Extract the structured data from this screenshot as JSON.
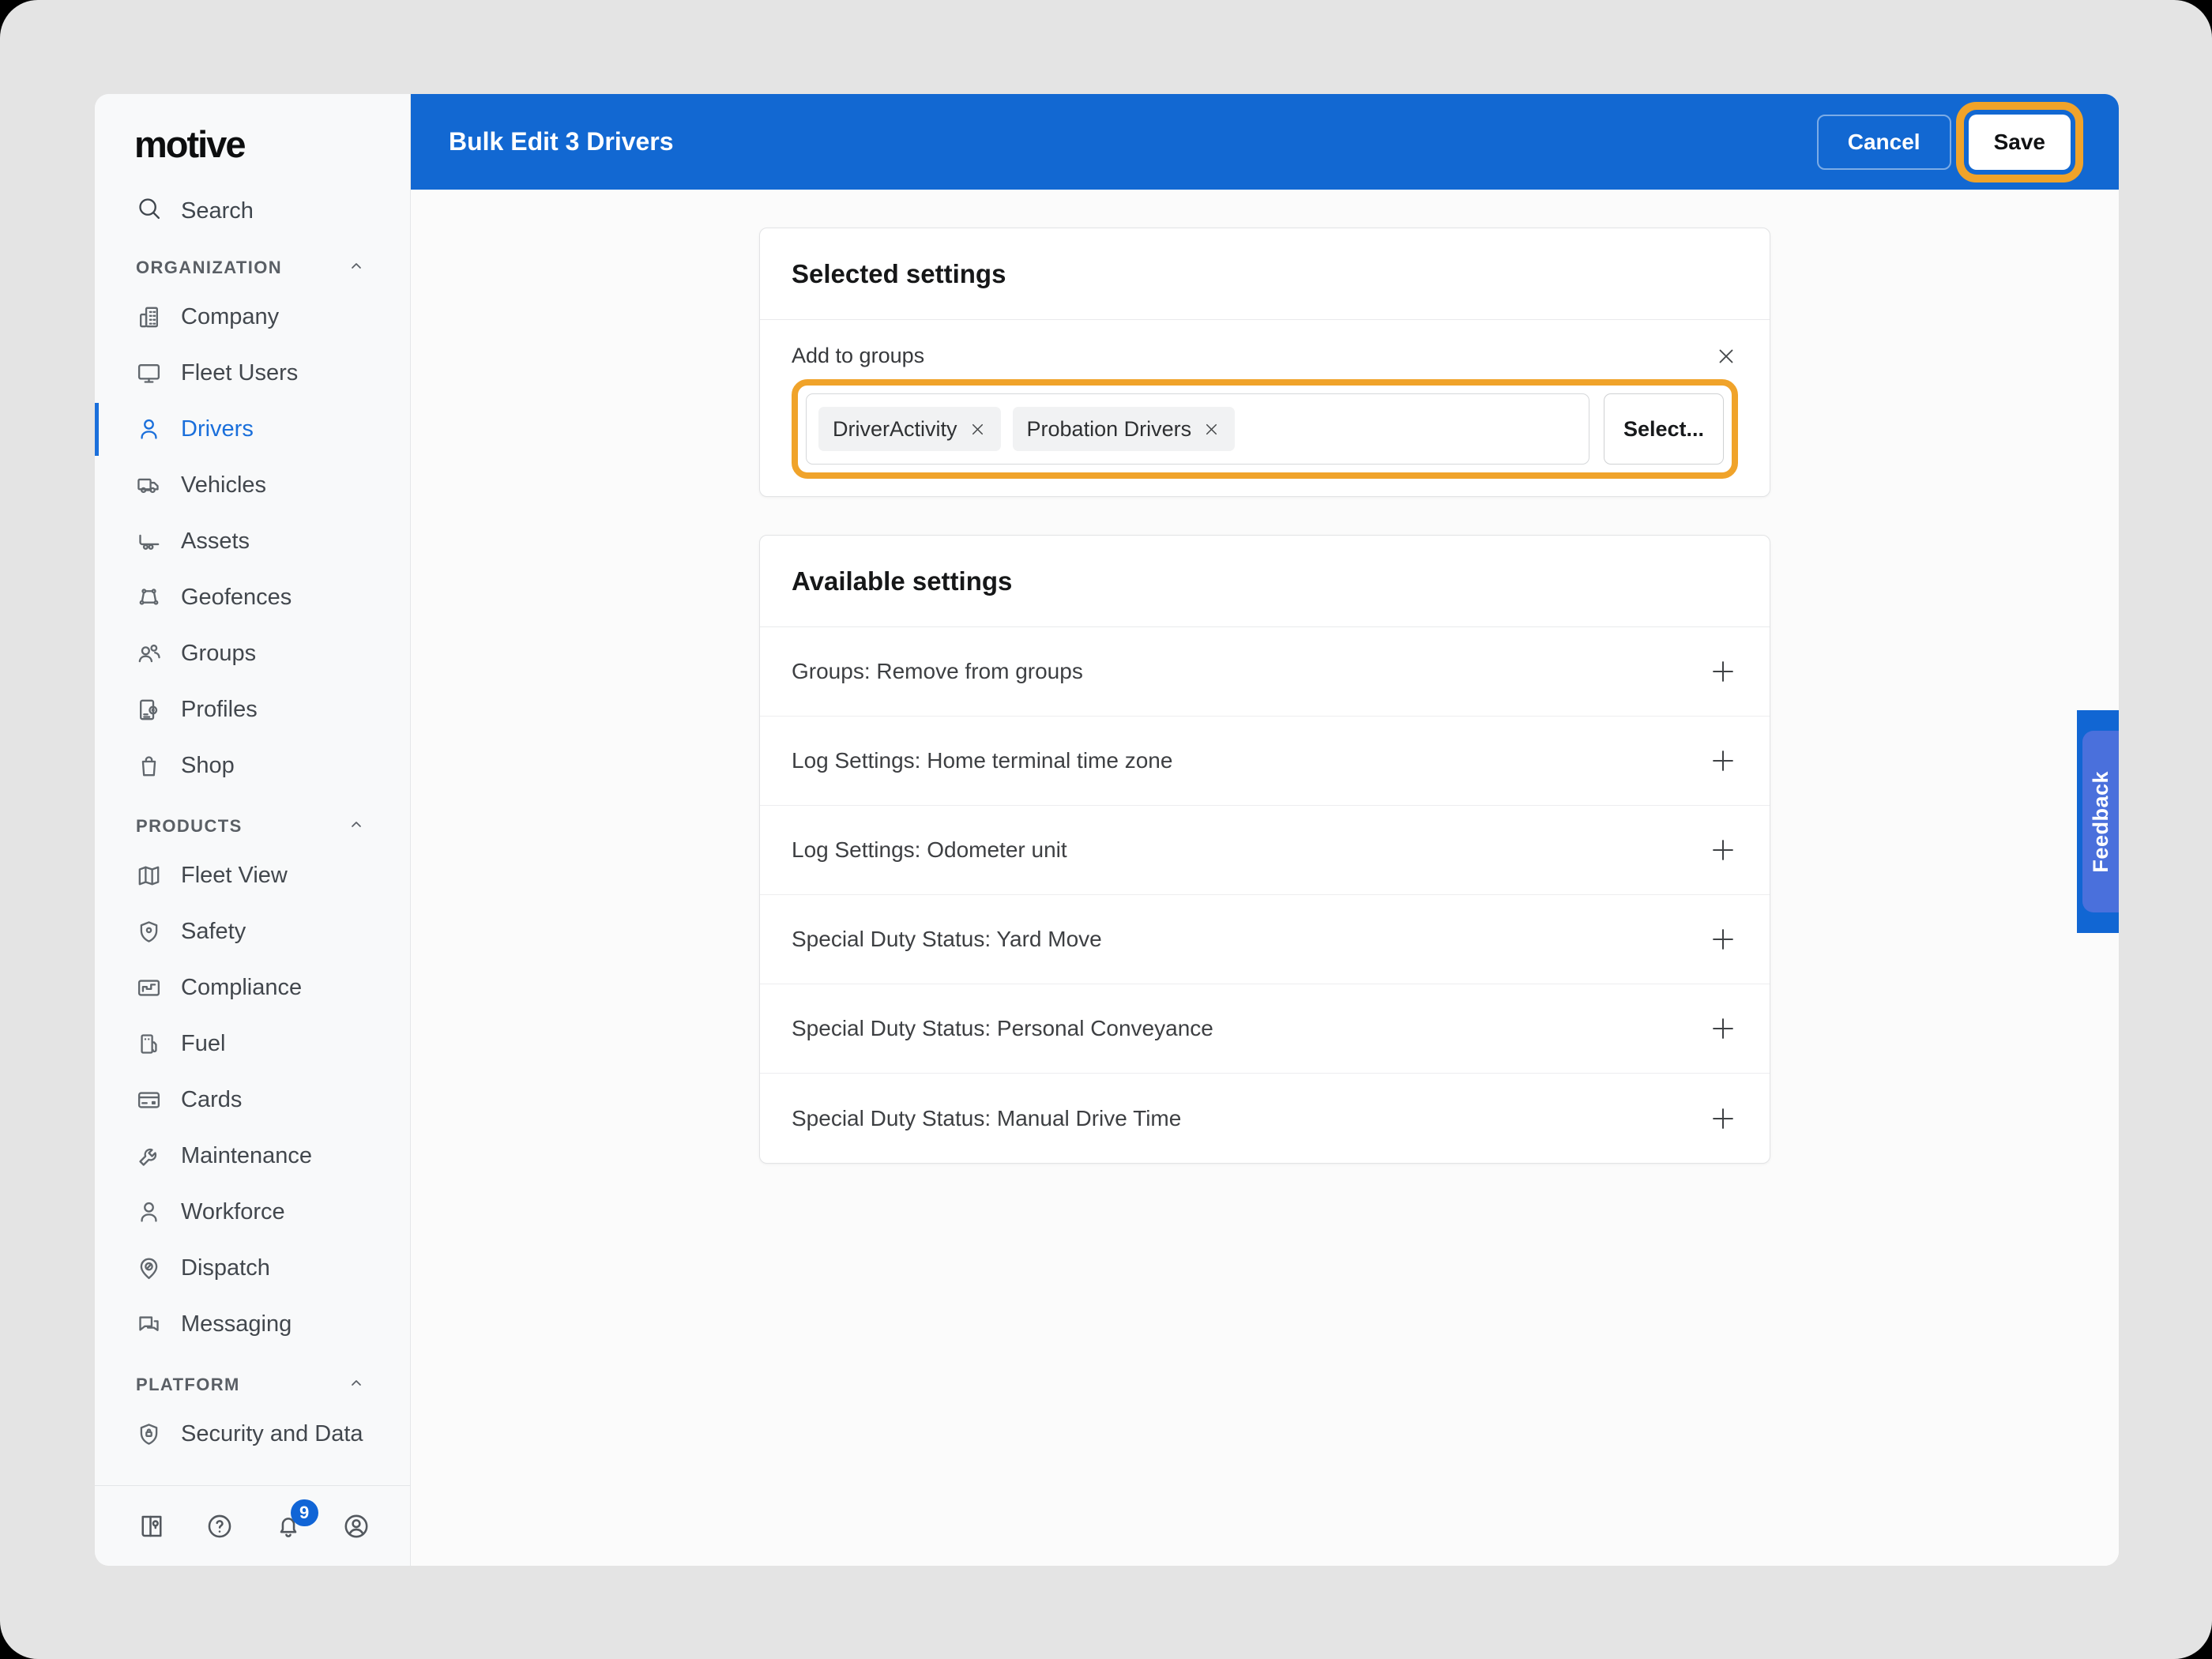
{
  "header": {
    "title": "Bulk Edit 3 Drivers",
    "cancel_label": "Cancel",
    "save_label": "Save"
  },
  "sidebar": {
    "logo": "motive",
    "search": {
      "label": "Search",
      "icon": "search-icon"
    },
    "sections": [
      {
        "title": "ORGANIZATION",
        "items": [
          {
            "label": "Company",
            "icon": "building-icon"
          },
          {
            "label": "Fleet Users",
            "icon": "monitor-icon"
          },
          {
            "label": "Drivers",
            "icon": "person-icon",
            "selected": true
          },
          {
            "label": "Vehicles",
            "icon": "truck-icon"
          },
          {
            "label": "Assets",
            "icon": "trailer-icon"
          },
          {
            "label": "Geofences",
            "icon": "geofence-icon"
          },
          {
            "label": "Groups",
            "icon": "people-icon"
          },
          {
            "label": "Profiles",
            "icon": "profile-gear-icon"
          },
          {
            "label": "Shop",
            "icon": "shopping-bag-icon"
          }
        ]
      },
      {
        "title": "PRODUCTS",
        "items": [
          {
            "label": "Fleet View",
            "icon": "map-icon"
          },
          {
            "label": "Safety",
            "icon": "shield-icon"
          },
          {
            "label": "Compliance",
            "icon": "steps-chart-icon"
          },
          {
            "label": "Fuel",
            "icon": "fuel-pump-icon"
          },
          {
            "label": "Cards",
            "icon": "credit-card-icon"
          },
          {
            "label": "Maintenance",
            "icon": "wrench-icon"
          },
          {
            "label": "Workforce",
            "icon": "person-icon"
          },
          {
            "label": "Dispatch",
            "icon": "dispatch-pin-icon"
          },
          {
            "label": "Messaging",
            "icon": "chat-bubbles-icon"
          }
        ]
      },
      {
        "title": "PLATFORM",
        "items": [
          {
            "label": "Security and Data",
            "icon": "shield-lock-icon"
          }
        ]
      }
    ],
    "footer_icons": [
      {
        "name": "guide-map-icon"
      },
      {
        "name": "help-icon"
      },
      {
        "name": "notifications-bell-icon",
        "badge": "9"
      },
      {
        "name": "account-icon"
      }
    ]
  },
  "main": {
    "selected_settings": {
      "title": "Selected settings",
      "group_setting": {
        "label": "Add to groups",
        "chips": [
          {
            "label": "DriverActivity"
          },
          {
            "label": "Probation Drivers"
          }
        ],
        "select_button": "Select..."
      }
    },
    "available_settings": {
      "title": "Available settings",
      "rows": [
        "Groups: Remove from groups",
        "Log Settings: Home terminal time zone",
        "Log Settings: Odometer unit",
        "Special Duty Status: Yard Move",
        "Special Duty Status: Personal Conveyance",
        "Special Duty Status: Manual Drive Time"
      ]
    }
  },
  "feedback_tab": {
    "label": "Feedback"
  },
  "colors": {
    "header_blue": "#1268d2",
    "accent_blue": "#1a6fdb",
    "highlight_orange": "#f0a32a",
    "feedback_inner_blue": "#4a70dc",
    "badge_blue": "#1165d6"
  }
}
